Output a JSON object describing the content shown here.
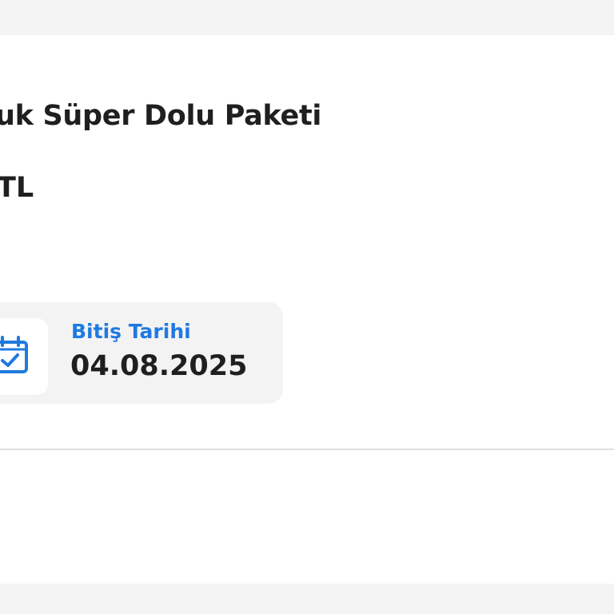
{
  "package": {
    "title": "uk Süper Dolu Paketi",
    "price_text": "TL"
  },
  "end_date": {
    "label": "Bitiş Tarihi",
    "value": "04.08.2025",
    "icon": "calendar-check-icon"
  },
  "colors": {
    "accent": "#1f7ae0",
    "text": "#1f1f1f",
    "page_background": "#f4f4f4",
    "card_background": "#ffffff",
    "info_box_background": "#f3f3f3"
  }
}
